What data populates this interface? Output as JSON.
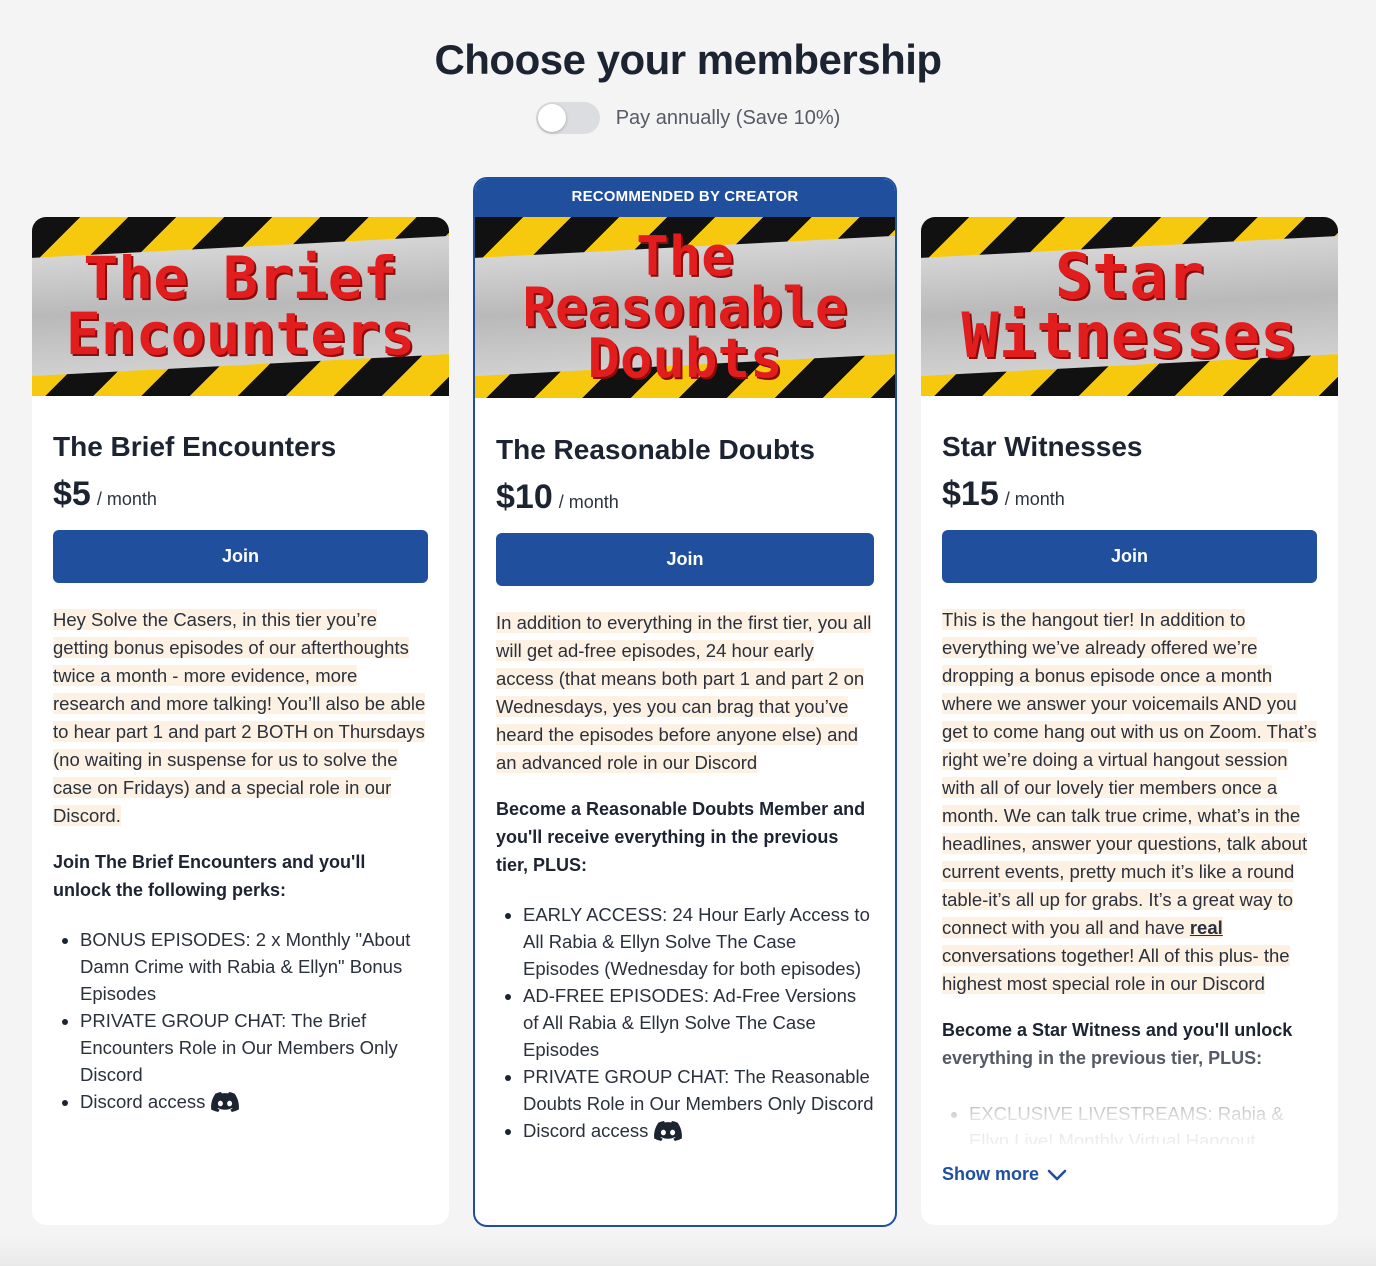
{
  "page": {
    "title": "Choose your membership",
    "toggle_label": "Pay annually (Save 10%)",
    "toggle_on": false
  },
  "colors": {
    "accent": "#1f4f9d",
    "highlight": "#fdf1e3",
    "background": "#f4f4f5"
  },
  "tiers": [
    {
      "hero_lines": [
        "The Brief",
        "Encounters"
      ],
      "name": "The Brief Encounters",
      "price": "$5",
      "per": "/ month",
      "join_label": "Join",
      "description": "Hey Solve the Casers, in this tier you’re getting bonus episodes of our afterthoughts twice a month - more evidence, more research and more talking! You’ll also be able to hear part 1 and part 2 BOTH on Thursdays (no waiting in suspense for us to solve the case on Fridays) and a special role in our Discord.",
      "perks_heading": "Join The Brief Encounters and you'll unlock the following perks:",
      "perks": [
        "BONUS EPISODES: 2 x Monthly \"About Damn Crime with Rabia & Ellyn\" Bonus Episodes",
        "PRIVATE GROUP CHAT: The Brief Encounters Role in Our Members Only Discord",
        "Discord access"
      ]
    },
    {
      "badge": "RECOMMENDED BY CREATOR",
      "hero_lines": [
        "The",
        "Reasonable",
        "Doubts"
      ],
      "name": "The Reasonable Doubts",
      "price": "$10",
      "per": "/ month",
      "join_label": "Join",
      "description": "In addition to everything in the first tier, you all will get ad-free episodes, 24 hour early access (that means both part 1 and part 2 on Wednesdays, yes you can brag that you’ve heard the episodes before anyone else) and an advanced role in our Discord",
      "perks_heading": "Become a Reasonable Doubts Member and you'll receive everything in the previous tier, PLUS:",
      "perks": [
        "EARLY ACCESS: 24 Hour Early Access to All Rabia & Ellyn Solve The Case Episodes (Wednesday for both episodes)",
        "AD-FREE EPISODES: Ad-Free Versions of All Rabia & Ellyn Solve The Case Episodes",
        "PRIVATE GROUP CHAT: The Reasonable Doubts Role in Our Members Only Discord",
        "Discord access"
      ]
    },
    {
      "hero_lines": [
        "Star",
        "Witnesses"
      ],
      "name": "Star Witnesses",
      "price": "$15",
      "per": "/ month",
      "join_label": "Join",
      "description_before": "This is the hangout tier! In addition to everything we’ve already offered we’re dropping a bonus episode once a month where we answer your voicemails AND you get to come hang out with us on Zoom. That’s right we’re doing a virtual hangout session with all of our lovely tier members once a month. We can talk true crime, what’s in the headlines, answer your questions, talk about current events, pretty much it’s like a round table-it’s all up for grabs. It’s a great way to connect with you all and have ",
      "description_emph": "real",
      "description_after": " conversations together! All of this plus- the highest most special role in our Discord",
      "perks_heading_a": "Become a Star Witness and you'll unlock",
      "perks_heading_b": "everything in the previous tier, PLUS:",
      "perks": [
        "EXCLUSIVE LIVESTREAMS: Rabia & Ellyn Live! Monthly Virtual Hangout"
      ],
      "show_more": "Show more"
    }
  ]
}
